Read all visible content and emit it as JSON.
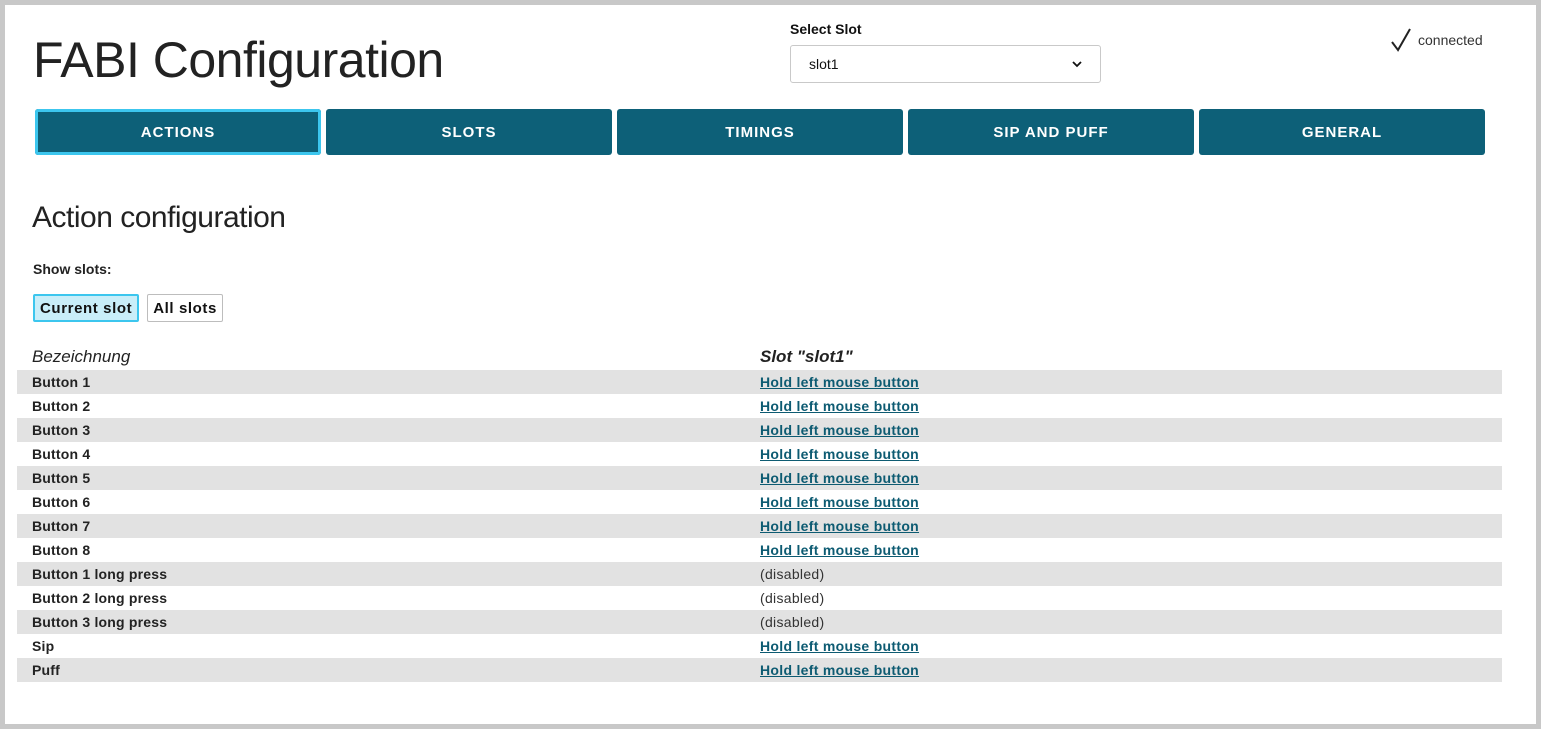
{
  "header": {
    "title": "FABI Configuration",
    "select_slot_label": "Select Slot",
    "selected_slot": "slot1",
    "status_text": "connected"
  },
  "tabs": [
    {
      "label": "ACTIONS",
      "active": true
    },
    {
      "label": "SLOTS",
      "active": false
    },
    {
      "label": "TIMINGS",
      "active": false
    },
    {
      "label": "SIP AND PUFF",
      "active": false
    },
    {
      "label": "GENERAL",
      "active": false
    }
  ],
  "main": {
    "section_title": "Action configuration",
    "show_slots_label": "Show slots:",
    "toggle": {
      "current_slot": "Current slot",
      "all_slots": "All slots"
    },
    "table": {
      "col_name": "Bezeichnung",
      "col_slot": "Slot \"slot1\"",
      "rows": [
        {
          "name": "Button 1",
          "action": "Hold left mouse button"
        },
        {
          "name": "Button 2",
          "action": "Hold left mouse button"
        },
        {
          "name": "Button 3",
          "action": "Hold left mouse button"
        },
        {
          "name": "Button 4",
          "action": "Hold left mouse button"
        },
        {
          "name": "Button 5",
          "action": "Hold left mouse button"
        },
        {
          "name": "Button 6",
          "action": "Hold left mouse button"
        },
        {
          "name": "Button 7",
          "action": "Hold left mouse button"
        },
        {
          "name": "Button 8",
          "action": "Hold left mouse button"
        },
        {
          "name": "Button 1 long press",
          "action": "(disabled)"
        },
        {
          "name": "Button 2 long press",
          "action": "(disabled)"
        },
        {
          "name": "Button 3 long press",
          "action": "(disabled)"
        },
        {
          "name": "Sip",
          "action": "Hold left mouse button"
        },
        {
          "name": "Puff",
          "action": "Hold left mouse button"
        }
      ]
    }
  },
  "colors": {
    "tab_bg": "#0d6078",
    "active_outline": "#3cc6ee",
    "row_stripe": "#e2e2e2",
    "link": "#0d5b72"
  },
  "icons": {
    "status": "check-icon",
    "select": "chevron-down-icon"
  }
}
